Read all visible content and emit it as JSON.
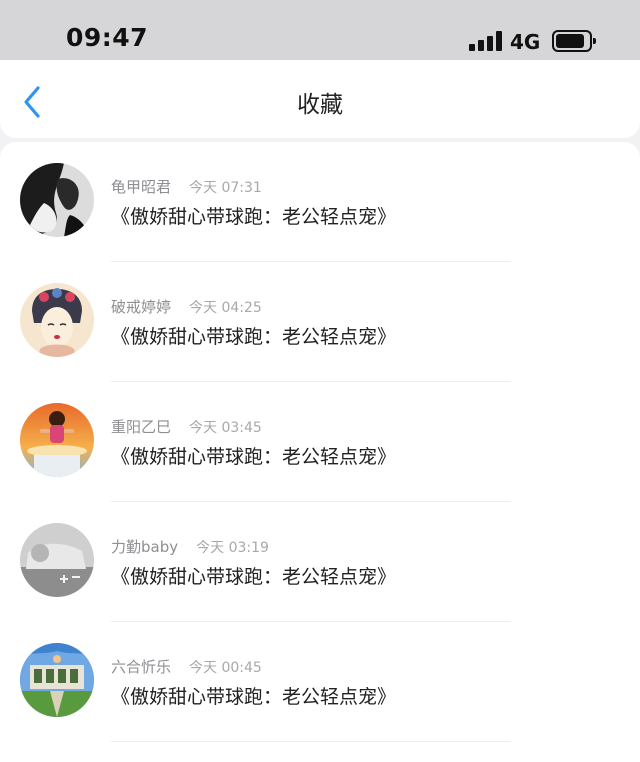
{
  "status_bar": {
    "time": "09:47",
    "network": "4G",
    "signal_icon": "signal-bars-icon",
    "battery_icon": "battery-icon"
  },
  "nav": {
    "title": "收藏",
    "back_icon": "chevron-left-icon",
    "accent_color": "#2f95f0"
  },
  "items": [
    {
      "author": "龟甲昭君",
      "time": "今天 07:31",
      "title": "《傲娇甜心带球跑：老公轻点宠》"
    },
    {
      "author": "破戒婷婷",
      "time": "今天 04:25",
      "title": "《傲娇甜心带球跑：老公轻点宠》"
    },
    {
      "author": "重阳乙巳",
      "time": "今天 03:45",
      "title": "《傲娇甜心带球跑：老公轻点宠》"
    },
    {
      "author": "力勤baby",
      "time": "今天 03:19",
      "title": "《傲娇甜心带球跑：老公轻点宠》"
    },
    {
      "author": "六合忻乐",
      "time": "今天 00:45",
      "title": "《傲娇甜心带球跑：老公轻点宠》"
    }
  ]
}
